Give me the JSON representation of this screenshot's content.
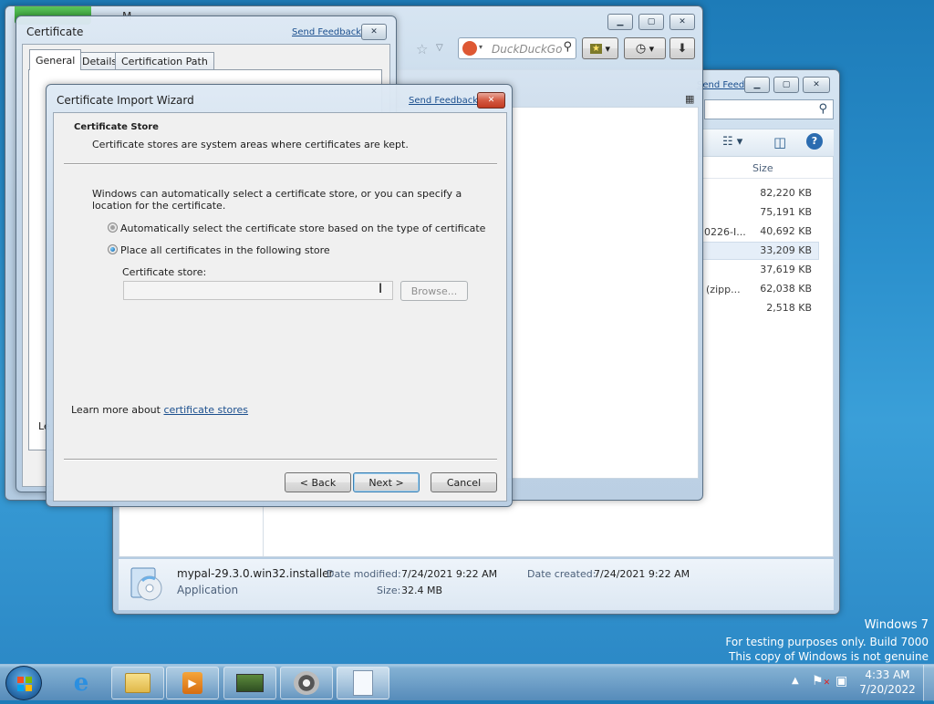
{
  "desktop": {
    "watermark": {
      "line1": "Windows 7",
      "line2": "For testing purposes only. Build 7000",
      "line3": "This copy of Windows is not genuine"
    }
  },
  "explorer": {
    "send_feedback": "Send Feedback",
    "size_header": "Size",
    "partial_names": [
      "0226-I...",
      "(zipp..."
    ],
    "sizes": [
      "82,220 KB",
      "75,191 KB",
      "40,692 KB",
      "33,209 KB",
      "37,619 KB",
      "62,038 KB",
      "2,518 KB"
    ],
    "details": {
      "filename": "mypal-29.3.0.win32.installer",
      "type": "Application",
      "modified_label": "Date modified:",
      "modified_value": "7/24/2021 9:22 AM",
      "created_label": "Date created:",
      "created_value": "7/24/2021 9:22 AM",
      "size_label": "Size:",
      "size_value": "32.4 MB"
    }
  },
  "browser": {
    "search_placeholder": "DuckDuckGo",
    "partial_title": "M"
  },
  "certificate": {
    "title": "Certificate",
    "send_feedback": "Send Feedback",
    "tabs": [
      "General",
      "Details",
      "Certification Path"
    ],
    "partial_text": "Le"
  },
  "wizard": {
    "title": "Certificate Import Wizard",
    "send_feedback": "Send Feedback",
    "heading": "Certificate Store",
    "subheading": "Certificate stores are system areas where certificates are kept.",
    "intro": "Windows can automatically select a certificate store, or you can specify a location for the certificate.",
    "option_auto": "Automatically select the certificate store based on the type of certificate",
    "option_place": "Place all certificates in the following store",
    "store_label": "Certificate store:",
    "store_value": "",
    "browse": "Browse...",
    "learn_prefix": "Learn more about ",
    "learn_link": "certificate stores",
    "back": "< Back",
    "next": "Next >",
    "cancel": "Cancel"
  },
  "clock": {
    "time": "4:33 AM",
    "date": "7/20/2022"
  }
}
